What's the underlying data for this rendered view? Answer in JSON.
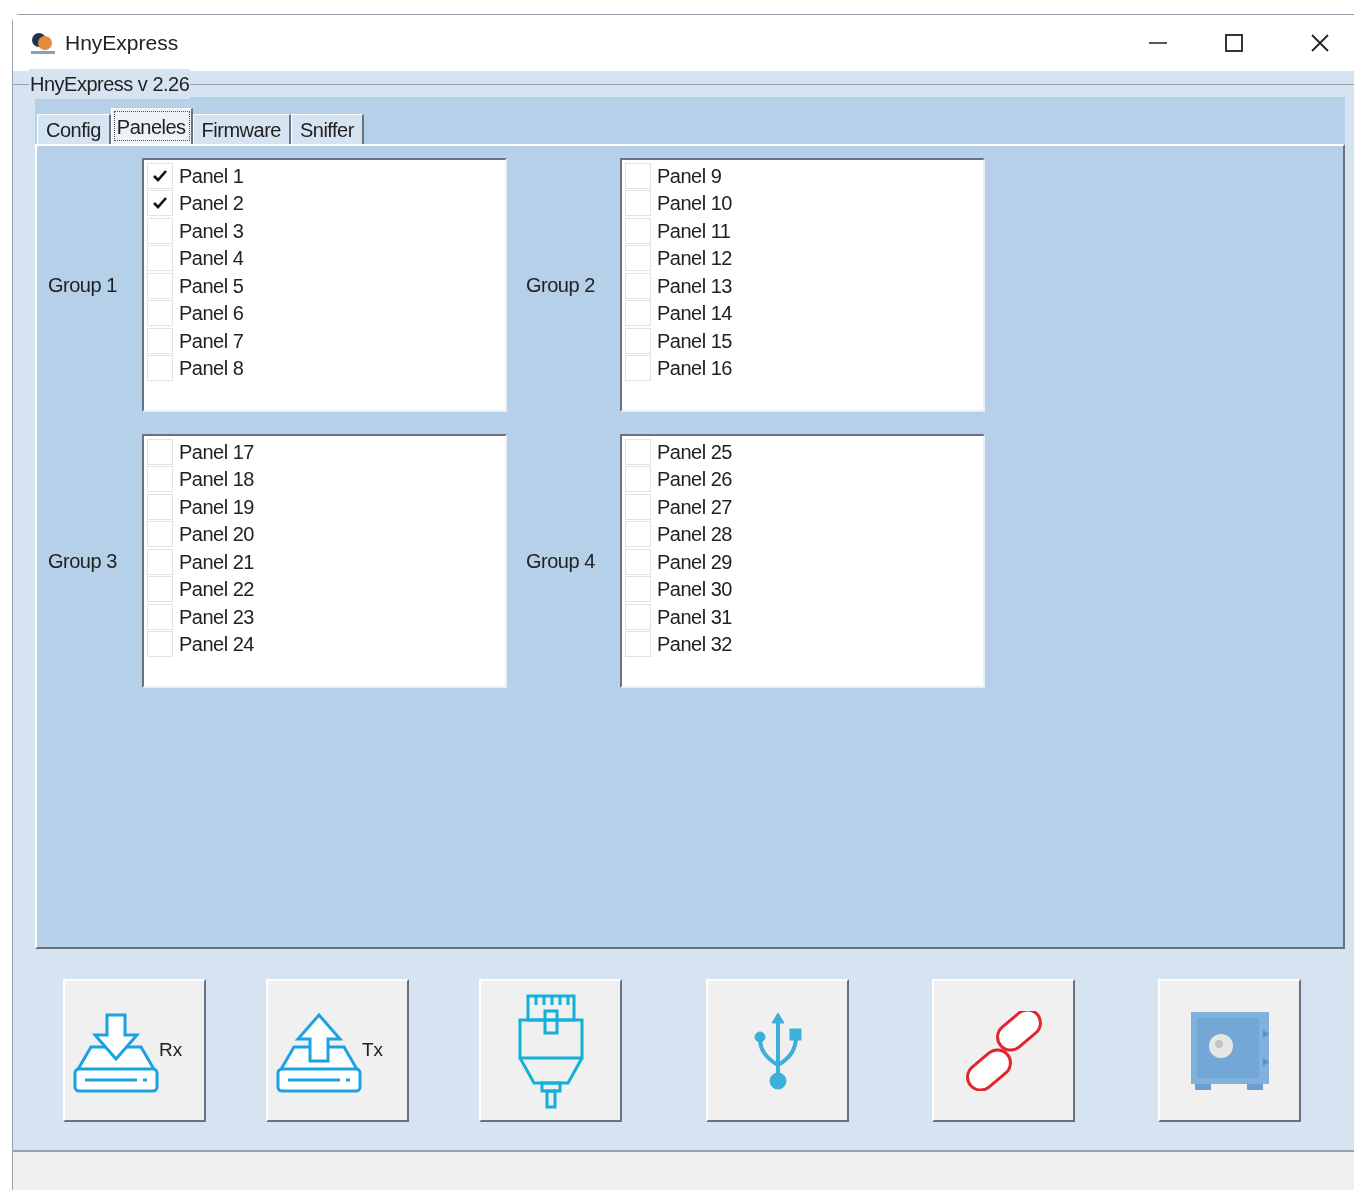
{
  "window": {
    "title": "HnyExpress"
  },
  "group_box": {
    "title": "HnyExpress v 2.26"
  },
  "tabs": [
    {
      "label": "Config",
      "selected": false
    },
    {
      "label": "Paneles",
      "selected": true
    },
    {
      "label": "Firmware",
      "selected": false
    },
    {
      "label": "Sniffer",
      "selected": false
    }
  ],
  "groups": [
    {
      "label": "Group 1",
      "panels": [
        {
          "label": "Panel 1",
          "checked": true
        },
        {
          "label": "Panel 2",
          "checked": true
        },
        {
          "label": "Panel 3",
          "checked": false
        },
        {
          "label": "Panel 4",
          "checked": false
        },
        {
          "label": "Panel 5",
          "checked": false
        },
        {
          "label": "Panel 6",
          "checked": false
        },
        {
          "label": "Panel 7",
          "checked": false
        },
        {
          "label": "Panel 8",
          "checked": false
        }
      ]
    },
    {
      "label": "Group 2",
      "panels": [
        {
          "label": "Panel 9",
          "checked": false
        },
        {
          "label": "Panel 10",
          "checked": false
        },
        {
          "label": "Panel 11",
          "checked": false
        },
        {
          "label": "Panel 12",
          "checked": false
        },
        {
          "label": "Panel 13",
          "checked": false
        },
        {
          "label": "Panel 14",
          "checked": false
        },
        {
          "label": "Panel 15",
          "checked": false
        },
        {
          "label": "Panel 16",
          "checked": false
        }
      ]
    },
    {
      "label": "Group 3",
      "panels": [
        {
          "label": "Panel 17",
          "checked": false
        },
        {
          "label": "Panel 18",
          "checked": false
        },
        {
          "label": "Panel 19",
          "checked": false
        },
        {
          "label": "Panel 20",
          "checked": false
        },
        {
          "label": "Panel 21",
          "checked": false
        },
        {
          "label": "Panel 22",
          "checked": false
        },
        {
          "label": "Panel 23",
          "checked": false
        },
        {
          "label": "Panel 24",
          "checked": false
        }
      ]
    },
    {
      "label": "Group 4",
      "panels": [
        {
          "label": "Panel 25",
          "checked": false
        },
        {
          "label": "Panel 26",
          "checked": false
        },
        {
          "label": "Panel 27",
          "checked": false
        },
        {
          "label": "Panel 28",
          "checked": false
        },
        {
          "label": "Panel 29",
          "checked": false
        },
        {
          "label": "Panel 30",
          "checked": false
        },
        {
          "label": "Panel 31",
          "checked": false
        },
        {
          "label": "Panel 32",
          "checked": false
        }
      ]
    }
  ],
  "buttons": [
    {
      "kind": "rx",
      "label": "Rx"
    },
    {
      "kind": "tx",
      "label": "Tx"
    },
    {
      "kind": "ethernet"
    },
    {
      "kind": "usb"
    },
    {
      "kind": "link"
    },
    {
      "kind": "safe"
    }
  ]
}
